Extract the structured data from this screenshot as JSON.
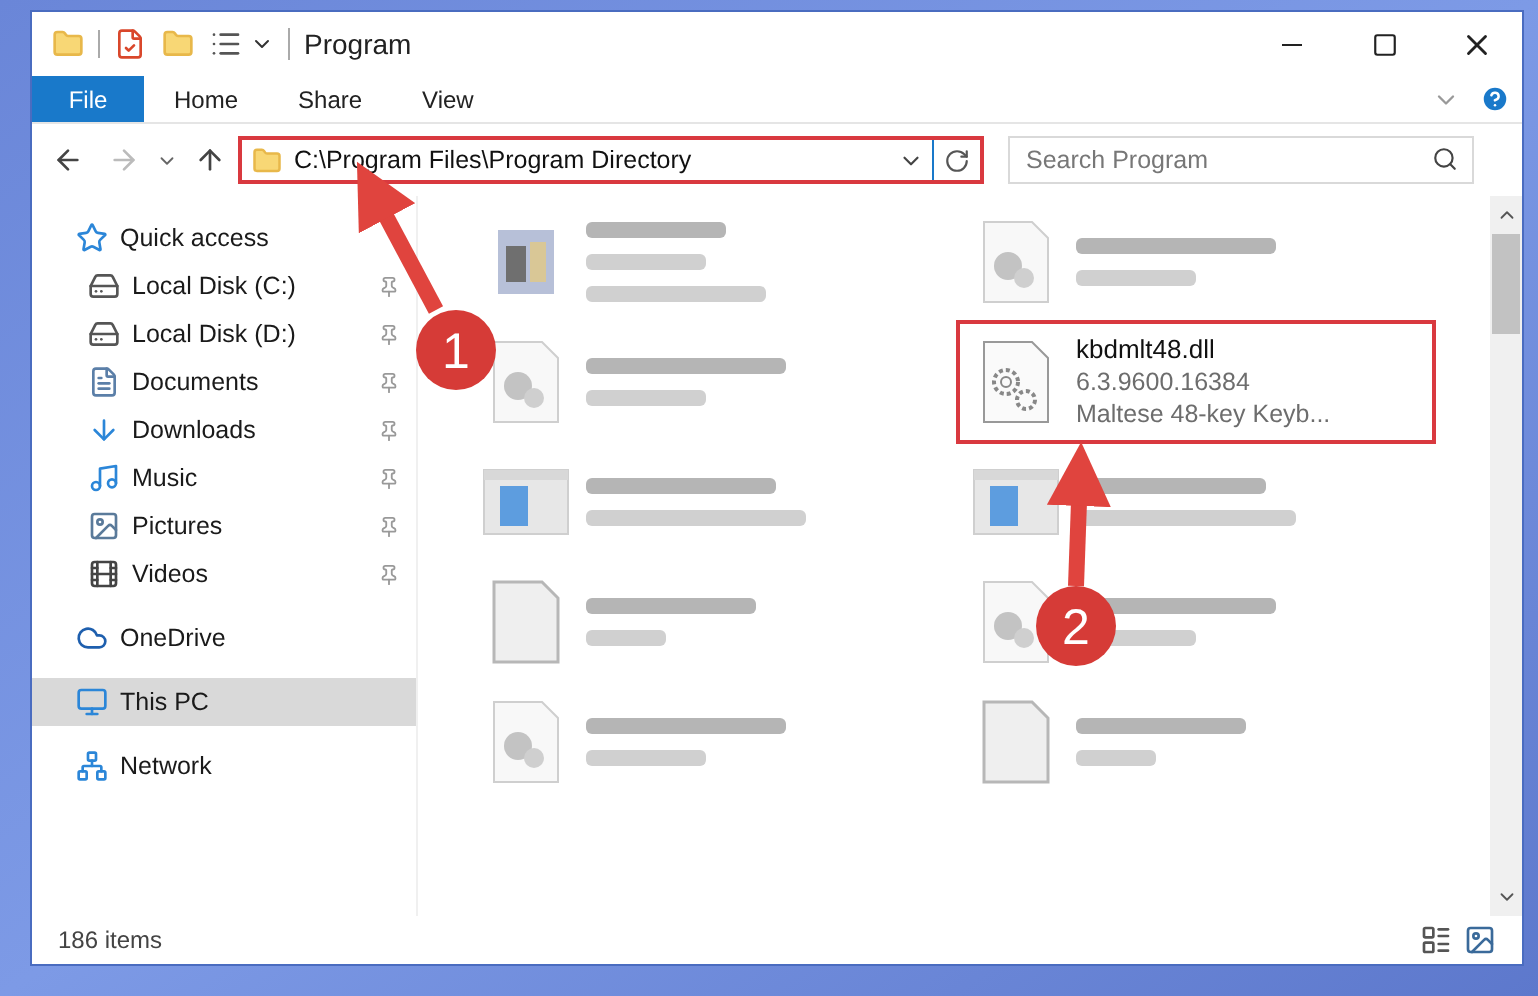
{
  "window": {
    "title": "Program"
  },
  "ribbon_tabs": [
    {
      "label": "File",
      "kind": "file"
    },
    {
      "label": "Home",
      "kind": "tab"
    },
    {
      "label": "Share",
      "kind": "tab"
    },
    {
      "label": "View",
      "kind": "tab"
    }
  ],
  "address_bar": {
    "path": "C:\\Program Files\\Program Directory",
    "highlighted": true
  },
  "search": {
    "placeholder": "Search Program"
  },
  "sidebar": {
    "items": [
      {
        "label": "Quick access",
        "kind": "star",
        "pinned": false,
        "selected": false,
        "children": [
          {
            "label": "Local Disk (C:)",
            "kind": "drive",
            "pinned": true,
            "selected": false
          },
          {
            "label": "Local Disk (D:)",
            "kind": "drive",
            "pinned": true,
            "selected": false
          },
          {
            "label": "Documents",
            "kind": "documents",
            "pinned": true,
            "selected": false
          },
          {
            "label": "Downloads",
            "kind": "downloads",
            "pinned": true,
            "selected": false
          },
          {
            "label": "Music",
            "kind": "music",
            "pinned": true,
            "selected": false
          },
          {
            "label": "Pictures",
            "kind": "pictures",
            "pinned": true,
            "selected": false
          },
          {
            "label": "Videos",
            "kind": "videos",
            "pinned": true,
            "selected": false
          }
        ]
      },
      {
        "label": "OneDrive",
        "kind": "cloud",
        "pinned": false,
        "selected": false
      },
      {
        "label": "This PC",
        "kind": "pc",
        "pinned": false,
        "selected": true
      },
      {
        "label": "Network",
        "kind": "network",
        "pinned": false,
        "selected": false
      }
    ]
  },
  "files": [
    {
      "kind": "app",
      "blurred": true,
      "highlighted": false
    },
    {
      "kind": "dll",
      "blurred": true,
      "highlighted": false
    },
    {
      "kind": "dll",
      "blurred": true,
      "highlighted": false
    },
    {
      "kind": "gear",
      "name": "kbdmlt48.dll",
      "details": [
        "6.3.9600.16384",
        "Maltese 48-key Keyb..."
      ],
      "blurred": false,
      "highlighted": true
    },
    {
      "kind": "installer",
      "blurred": true,
      "highlighted": false
    },
    {
      "kind": "installer",
      "blurred": true,
      "highlighted": false
    },
    {
      "kind": "blank",
      "blurred": true,
      "highlighted": false
    },
    {
      "kind": "dll",
      "blurred": true,
      "highlighted": false
    },
    {
      "kind": "dll",
      "blurred": true,
      "highlighted": false
    },
    {
      "kind": "blank",
      "blurred": true,
      "highlighted": false
    }
  ],
  "status_bar": {
    "item_count": "186 items"
  },
  "annotations": [
    {
      "label": "1"
    },
    {
      "label": "2"
    }
  ]
}
